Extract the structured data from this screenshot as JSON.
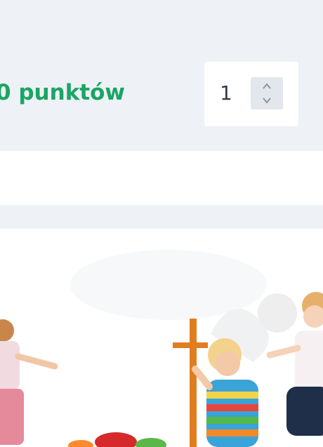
{
  "product": {
    "points_text": "0 punktów",
    "quantity": "1"
  },
  "banner": {
    "scene": "children-playing-icon"
  },
  "colors": {
    "accent_green": "#1aa564",
    "panel_bg": "#eef1f5"
  }
}
